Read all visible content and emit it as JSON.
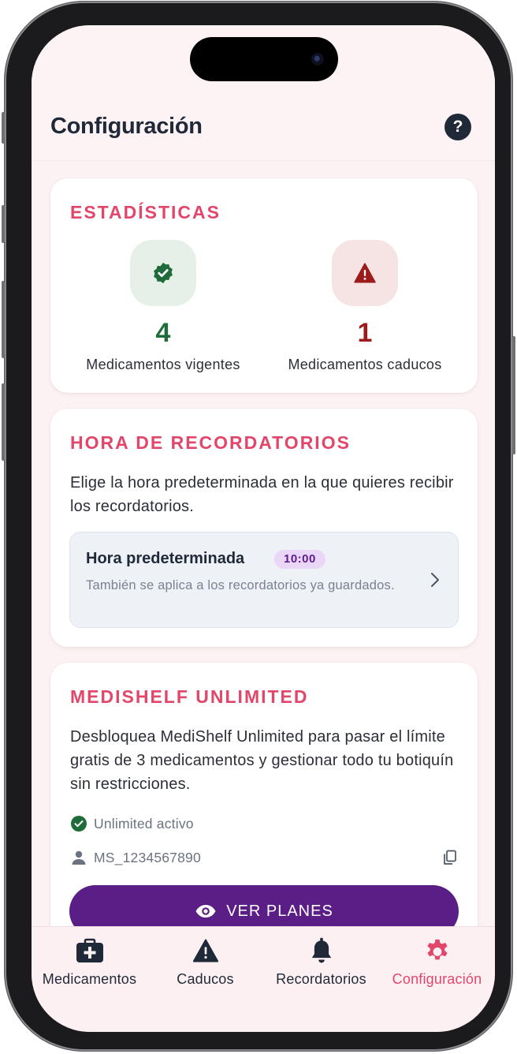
{
  "header": {
    "title": "Configuración",
    "help_label": "?"
  },
  "stats": {
    "title": "ESTADÍSTICAS",
    "valid": {
      "count": "4",
      "label": "Medicamentos vigentes",
      "color": "#1f6b3a"
    },
    "expired": {
      "count": "1",
      "label": "Medicamentos caducos",
      "color": "#9c1c1c"
    }
  },
  "reminders": {
    "title": "HORA DE RECORDATORIOS",
    "description": "Elige la hora predeterminada en la que quieres recibir los recordatorios.",
    "default_time_label": "Hora predeterminada",
    "default_time_value": "10:00",
    "default_time_note": "También se aplica a los recordatorios ya guardados."
  },
  "unlimited": {
    "title": "MEDISHELF UNLIMITED",
    "description": "Desbloquea MediShelf Unlimited para pasar el límite gratis de 3 medicamentos y gestionar todo tu botiquín sin restricciones.",
    "status": "Unlimited activo",
    "user_id": "MS_1234567890",
    "plans_button": "VER PLANES"
  },
  "tabs": [
    {
      "label": "Medicamentos",
      "icon": "medical-kit-icon",
      "active": false
    },
    {
      "label": "Caducos",
      "icon": "warning-icon",
      "active": false
    },
    {
      "label": "Recordatorios",
      "icon": "bell-icon",
      "active": false
    },
    {
      "label": "Configuración",
      "icon": "gear-icon",
      "active": true
    }
  ],
  "colors": {
    "accent": "#e2466a",
    "primary_button": "#5b1e86",
    "text": "#1f2937"
  }
}
